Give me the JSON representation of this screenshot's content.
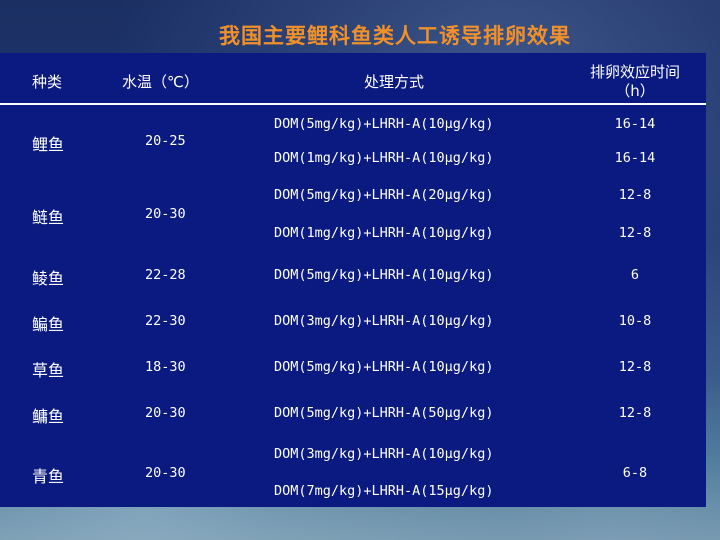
{
  "title": "我国主要鲤科鱼类人工诱导排卵效果",
  "headers": {
    "species": "种类",
    "water_temp": "水温（℃）",
    "method": "处理方式",
    "time_line1": "排卵效应时间",
    "time_line2": "（h）"
  },
  "rows": [
    {
      "species": "鲤鱼",
      "temp": "20-25",
      "methods": [
        "DOM(5mg/kg)+LHRH-A(10μg/kg)",
        "DOM(1mg/kg)+LHRH-A(10μg/kg)"
      ],
      "times": [
        "16-14",
        "16-14"
      ]
    },
    {
      "species": "鲢鱼",
      "temp": "20-30",
      "methods": [
        "DOM(5mg/kg)+LHRH-A(20μg/kg)",
        "DOM(1mg/kg)+LHRH-A(10μg/kg)"
      ],
      "times": [
        "12-8",
        "12-8"
      ]
    },
    {
      "species": "鲮鱼",
      "temp": "22-28",
      "methods": [
        "DOM(5mg/kg)+LHRH-A(10μg/kg)"
      ],
      "times": [
        "6"
      ]
    },
    {
      "species": "鳊鱼",
      "temp": "22-30",
      "methods": [
        "DOM(3mg/kg)+LHRH-A(10μg/kg)"
      ],
      "times": [
        "10-8"
      ]
    },
    {
      "species": "草鱼",
      "temp": "18-30",
      "methods": [
        "DOM(5mg/kg)+LHRH-A(10μg/kg)"
      ],
      "times": [
        "12-8"
      ]
    },
    {
      "species": "鳙鱼",
      "temp": "20-30",
      "methods": [
        "DOM(5mg/kg)+LHRH-A(50μg/kg)"
      ],
      "times": [
        "12-8"
      ]
    },
    {
      "species": "青鱼",
      "temp": "20-30",
      "methods": [
        "DOM(3mg/kg)+LHRH-A(10μg/kg)",
        "DOM(7mg/kg)+LHRH-A(15μg/kg)"
      ],
      "times": [
        "6-8"
      ]
    }
  ]
}
